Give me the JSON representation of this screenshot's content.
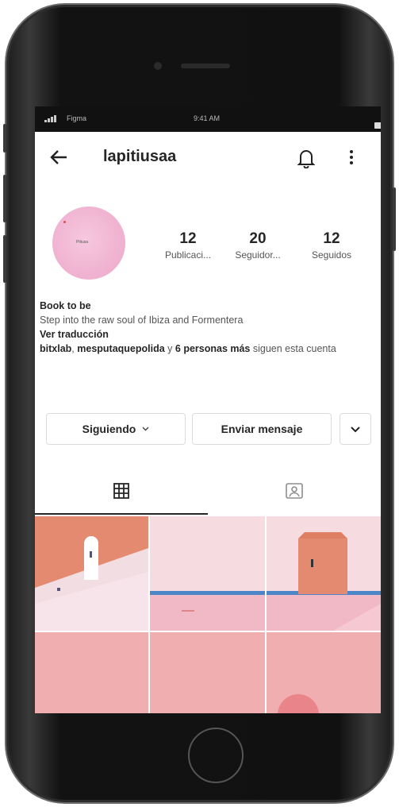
{
  "status_bar": {
    "carrier": "Figma",
    "time": "9:41 AM",
    "battery": "100%"
  },
  "header": {
    "username": "lapitiusaa"
  },
  "profile": {
    "avatar_text": "Pitiusa",
    "stats": [
      {
        "value": "12",
        "label": "Publicaci..."
      },
      {
        "value": "20",
        "label": "Seguidor..."
      },
      {
        "value": "12",
        "label": "Seguidos"
      }
    ],
    "bio": {
      "name": "Book to be",
      "description": "Step into the raw soul of Ibiza and Formentera",
      "translate": "Ver traducción",
      "followed_by_user1": "bitxlab",
      "followed_by_sep": ", ",
      "followed_by_user2": "mesputaquepolida",
      "followed_by_mid": " y ",
      "followed_by_others": "6 personas más",
      "followed_by_tail": " siguen esta cuenta"
    }
  },
  "actions": {
    "following_label": "Siguiendo",
    "message_label": "Enviar mensaje"
  },
  "tabs": [
    {
      "icon": "grid-icon"
    },
    {
      "icon": "tagged-icon"
    }
  ],
  "colors": {
    "terracotta": "#e2896b",
    "pink": "#f1aeb0",
    "light_pink": "#f3d3d8",
    "sea": "#4d86c8"
  }
}
